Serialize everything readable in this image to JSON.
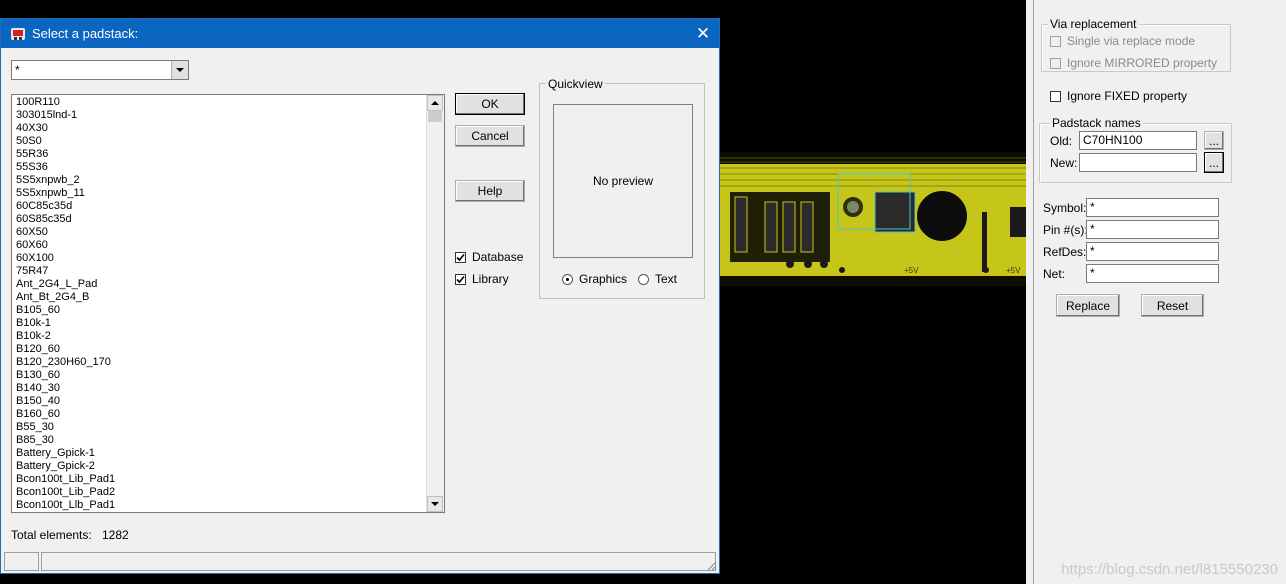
{
  "dialog": {
    "title": "Select a padstack:",
    "filter_value": "*",
    "buttons": {
      "ok": "OK",
      "cancel": "Cancel",
      "help": "Help"
    },
    "checkboxes": [
      {
        "label": "Database",
        "checked": true
      },
      {
        "label": "Library",
        "checked": true
      }
    ],
    "quickview": {
      "title": "Quickview",
      "placeholder": "No preview",
      "radios": [
        {
          "label": "Graphics",
          "selected": true
        },
        {
          "label": "Text",
          "selected": false
        }
      ]
    },
    "padstacks": [
      "100R110",
      "303015lnd-1",
      "40X30",
      "50S0",
      "55R36",
      "55S36",
      "5S5xnpwb_2",
      "5S5xnpwb_11",
      "60C85c35d",
      "60S85c35d",
      "60X50",
      "60X60",
      "60X100",
      "75R47",
      "Ant_2G4_L_Pad",
      "Ant_Bt_2G4_B",
      "B105_60",
      "B10k-1",
      "B10k-2",
      "B120_60",
      "B120_230H60_170",
      "B130_60",
      "B140_30",
      "B150_40",
      "B160_60",
      "B55_30",
      "B85_30",
      "Battery_Gpick-1",
      "Battery_Gpick-2",
      "Bcon100t_Lib_Pad1",
      "Bcon100t_Lib_Pad2",
      "Bcon100t_Llb_Pad1"
    ],
    "total_label": "Total elements:",
    "total_count": "1282"
  },
  "panel": {
    "via_replacement": {
      "title": "Via replacement",
      "options": [
        {
          "label": "Single via replace mode",
          "enabled": false,
          "checked": false
        },
        {
          "label": "Ignore MIRRORED property",
          "enabled": false,
          "checked": false
        }
      ]
    },
    "ignore_fixed": {
      "label": "Ignore FIXED property",
      "checked": false
    },
    "padstack_names": {
      "title": "Padstack names",
      "old_label": "Old:",
      "old_value": "C70HN100",
      "new_label": "New:",
      "new_value": "",
      "browse_label": "..."
    },
    "filters": [
      {
        "label": "Symbol:",
        "value": "*"
      },
      {
        "label": "Pin #(s):",
        "value": "*"
      },
      {
        "label": "RefDes:",
        "value": "*"
      },
      {
        "label": "Net:",
        "value": "*"
      }
    ],
    "buttons": {
      "replace": "Replace",
      "reset": "Reset"
    }
  },
  "pcb": {
    "labels": [
      "+5V",
      "+5V"
    ]
  },
  "watermark": "https://blog.csdn.net/l815550230"
}
